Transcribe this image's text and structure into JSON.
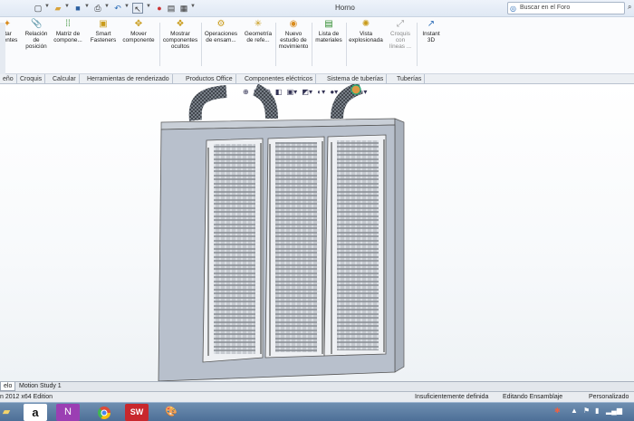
{
  "window": {
    "title": "Horno",
    "search_placeholder": "Buscar en el Foro"
  },
  "quick_access": [
    {
      "icon": "new-document-icon"
    },
    {
      "icon": "open-folder-icon"
    },
    {
      "icon": "save-icon"
    },
    {
      "icon": "print-icon"
    },
    {
      "icon": "undo-icon"
    },
    {
      "icon": "select-cursor-icon"
    },
    {
      "icon": "traffic-light-icon"
    },
    {
      "icon": "file-properties-icon"
    },
    {
      "icon": "options-icon"
    }
  ],
  "ribbon": {
    "commands": [
      {
        "label": "rtar\nonentes",
        "icon": "insert-components-icon"
      },
      {
        "label": "Relación\nde\nposición",
        "icon": "mate-icon"
      },
      {
        "label": "Matriz de\ncompone...",
        "icon": "component-pattern-icon"
      },
      {
        "label": "Smart\nFasteners",
        "icon": "smart-fasteners-icon"
      },
      {
        "label": "Mover\ncomponente",
        "icon": "move-component-icon"
      },
      {
        "label": "Mostrar\ncomponentes\nocultos",
        "icon": "show-hidden-components-icon"
      },
      {
        "label": "Operaciones\nde ensam...",
        "icon": "assembly-features-icon"
      },
      {
        "label": "Geometría\nde refe...",
        "icon": "reference-geometry-icon"
      },
      {
        "label": "Nuevo\nestudio de\nmovimiento",
        "icon": "new-motion-study-icon"
      },
      {
        "label": "Lista de\nmateriales",
        "icon": "bill-of-materials-icon"
      },
      {
        "label": "Vista\nexplosionada",
        "icon": "exploded-view-icon"
      },
      {
        "label": "Croquis\ncon\nlíneas ...",
        "icon": "explode-line-sketch-icon"
      },
      {
        "label": "Instant\n3D",
        "icon": "instant-3d-icon"
      }
    ]
  },
  "tabs": [
    "eño",
    "Croquis",
    "Calcular",
    "Herramientas de renderizado",
    "Productos Office",
    "Componentes eléctricos",
    "Sistema de tuberías",
    "Tuberías"
  ],
  "model_tabs": [
    "elo",
    "Motion Study 1"
  ],
  "status": {
    "edition": "n 2012 x64 Edition",
    "definition": "Insuficientemente definida",
    "mode": "Editando Ensamblaje",
    "units": "Personalizado"
  },
  "taskbar": {
    "apps": [
      "file-explorer-icon",
      "amazon-icon",
      "onenote-icon",
      "chrome-icon",
      "solidworks-icon",
      "paint-icon"
    ]
  },
  "colors": {
    "accent": "#2b6cb6",
    "model_gray": "#b8c0cc",
    "taskbar": "#5a7ba3"
  }
}
